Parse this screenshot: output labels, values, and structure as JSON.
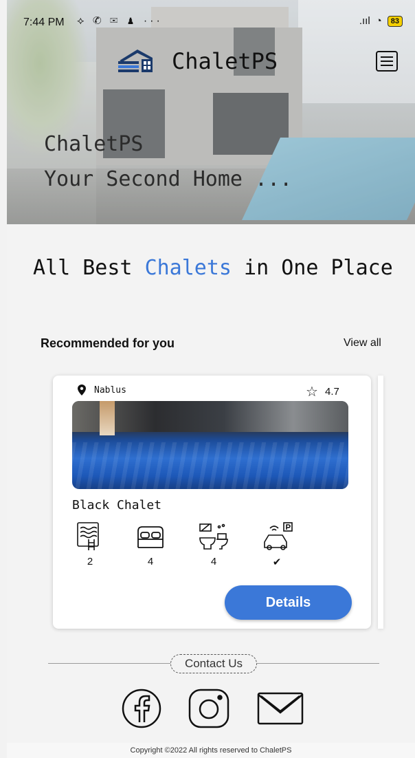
{
  "status_bar": {
    "time": "7:44 PM",
    "notification_icons": "⟡ ✆ ✉ ♟ ···",
    "signal": ".ııl",
    "wifi": "◔",
    "battery": "83"
  },
  "header": {
    "brand": "ChaletPS",
    "menu_icon": "list-icon"
  },
  "hero": {
    "title": "ChaletPS",
    "subtitle": "Your Second Home ..."
  },
  "headline": {
    "before": "All Best ",
    "highlight": "Chalets",
    "after": " in One Place",
    "highlight_color": "#3b78d8"
  },
  "recommended": {
    "title": "Recommended for you",
    "view_all": "View all"
  },
  "card": {
    "location": "Nablus",
    "rating": "4.7",
    "star_icon": "star-outline-icon",
    "name": "Black Chalet",
    "amenities": [
      {
        "icon": "pool-icon",
        "value": "2"
      },
      {
        "icon": "bed-icon",
        "value": "4"
      },
      {
        "icon": "bathroom-icon",
        "value": "4"
      },
      {
        "icon": "parking-icon",
        "value": "✔"
      }
    ],
    "details_button": "Details",
    "accent": "#3b78d8"
  },
  "footer": {
    "contact": "Contact Us",
    "socials": [
      "facebook-icon",
      "instagram-icon",
      "mail-icon"
    ],
    "copyright": "Copyright ©2022 All rights reserved to ChaletPS"
  }
}
